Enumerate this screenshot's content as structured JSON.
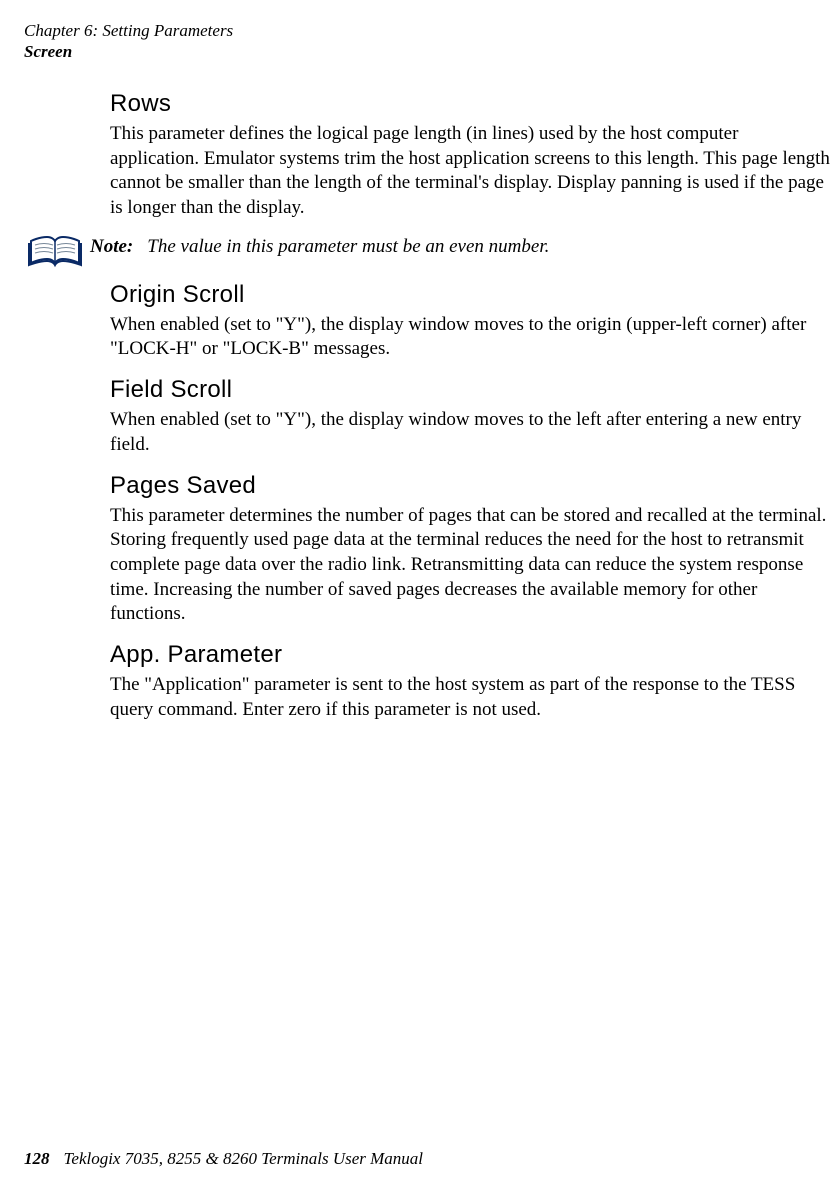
{
  "header": {
    "chapter_line": "Chapter 6: Setting Parameters",
    "section_line": "Screen"
  },
  "sections": {
    "rows": {
      "title": "Rows",
      "body": "This parameter defines the logical page length (in lines) used by the host computer application. Emulator systems trim the host application screens to this length. This page length cannot be smaller than the length of the terminal's display. Display panning is used if the page is longer than the display."
    },
    "note": {
      "label": "Note:",
      "body": "The value in this parameter must be an even number."
    },
    "origin_scroll": {
      "title": "Origin Scroll",
      "body": "When enabled (set to \"Y\"), the display window moves to the origin (upper-left corner) after \"LOCK-H\" or \"LOCK-B\" messages."
    },
    "field_scroll": {
      "title": "Field Scroll",
      "body": "When enabled (set to \"Y\"), the display window moves to the left after entering a new entry field."
    },
    "pages_saved": {
      "title": "Pages Saved",
      "body": "This parameter determines the number of pages that can be stored and recalled at the terminal. Storing frequently used page data at the terminal reduces the need for the host to retransmit complete page data over the radio link. Retransmitting data can reduce the system response time. Increasing the number of saved pages decreases the available memory for other functions."
    },
    "app_parameter": {
      "title": "App. Parameter",
      "body": "The \"Application\" parameter is sent to the host system as part of the response to the TESS query command. Enter zero if this parameter is not used."
    }
  },
  "footer": {
    "page_number": "128",
    "manual_title": "Teklogix 7035, 8255 & 8260 Terminals User Manual"
  }
}
